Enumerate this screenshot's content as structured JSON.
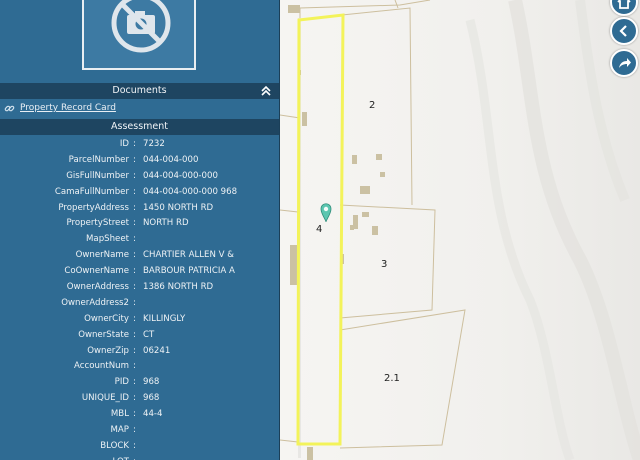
{
  "panel": {
    "documents_title": "Documents",
    "documents": [
      {
        "label": "Property Record Card"
      }
    ],
    "assessment_title": "Assessment",
    "fields": [
      {
        "key": "ID",
        "value": "7232"
      },
      {
        "key": "ParcelNumber",
        "value": "044-004-000"
      },
      {
        "key": "GisFullNumber",
        "value": "044-004-000-000"
      },
      {
        "key": "CamaFullNumber",
        "value": "044-004-000-000 968"
      },
      {
        "key": "PropertyAddress",
        "value": "1450 NORTH RD"
      },
      {
        "key": "PropertyStreet",
        "value": "NORTH RD"
      },
      {
        "key": "MapSheet",
        "value": ""
      },
      {
        "key": "OwnerName",
        "value": "CHARTIER ALLEN V &"
      },
      {
        "key": "CoOwnerName",
        "value": "BARBOUR PATRICIA A"
      },
      {
        "key": "OwnerAddress",
        "value": "1386 NORTH RD"
      },
      {
        "key": "OwnerAddress2",
        "value": ""
      },
      {
        "key": "OwnerCity",
        "value": "KILLINGLY"
      },
      {
        "key": "OwnerState",
        "value": "CT"
      },
      {
        "key": "OwnerZip",
        "value": "06241"
      },
      {
        "key": "AccountNum",
        "value": ""
      },
      {
        "key": "PID",
        "value": "968"
      },
      {
        "key": "UNIQUE_ID",
        "value": "968"
      },
      {
        "key": "MBL",
        "value": "44-4"
      },
      {
        "key": "MAP",
        "value": ""
      },
      {
        "key": "BLOCK",
        "value": ""
      },
      {
        "key": "LOT",
        "value": ""
      }
    ],
    "separator": ":"
  },
  "map": {
    "parcel_labels": [
      "2",
      "4",
      "3",
      "2.1"
    ],
    "highlight_color": "#f3f35a",
    "marker_color": "#5cc6b0",
    "buttons": [
      "home-icon",
      "chevron-left-icon",
      "share-icon"
    ]
  },
  "colors": {
    "panel": "#2f6b93",
    "header": "#1e4561"
  }
}
